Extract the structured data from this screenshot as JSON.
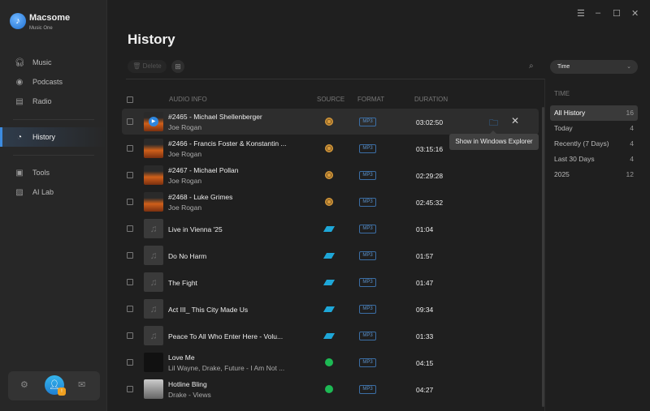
{
  "app": {
    "name": "Macsome",
    "subtitle": "Music One"
  },
  "sidebar": {
    "items": [
      {
        "label": "Music",
        "icon": "headphones-icon"
      },
      {
        "label": "Podcasts",
        "icon": "podcast-icon"
      },
      {
        "label": "Radio",
        "icon": "radio-icon"
      },
      {
        "label": "History",
        "icon": "clock-icon"
      },
      {
        "label": "Tools",
        "icon": "toolbox-icon"
      },
      {
        "label": "AI Lab",
        "icon": "ai-icon"
      }
    ]
  },
  "page": {
    "title": "History",
    "delete_label": "Delete",
    "filter": "Time"
  },
  "table": {
    "headers": {
      "audio_info": "AUDIO INFO",
      "source": "SOURCE",
      "format": "FORMAT",
      "duration": "DURATION"
    },
    "rows": [
      {
        "title": "#2465 - Michael Shellenberger",
        "artist": "Joe Rogan",
        "source": "podcast",
        "format": "MP3",
        "duration": "03:02:50",
        "thumb": "pod"
      },
      {
        "title": "#2466 - Francis Foster & Konstantin ...",
        "artist": "Joe Rogan",
        "source": "podcast",
        "format": "MP3",
        "duration": "03:15:16",
        "thumb": "pod"
      },
      {
        "title": "#2467 - Michael Pollan",
        "artist": "Joe Rogan",
        "source": "podcast",
        "format": "MP3",
        "duration": "02:29:28",
        "thumb": "pod"
      },
      {
        "title": "#2468 - Luke Grimes",
        "artist": "Joe Rogan",
        "source": "podcast",
        "format": "MP3",
        "duration": "02:45:32",
        "thumb": "pod"
      },
      {
        "title": "Live in Vienna '25",
        "artist": "",
        "source": "tidal",
        "format": "MP3",
        "duration": "01:04",
        "thumb": "note"
      },
      {
        "title": "Do No Harm",
        "artist": "",
        "source": "tidal",
        "format": "MP3",
        "duration": "01:57",
        "thumb": "note"
      },
      {
        "title": "The Fight",
        "artist": "",
        "source": "tidal",
        "format": "MP3",
        "duration": "01:47",
        "thumb": "note"
      },
      {
        "title": "Act III_ This City Made Us",
        "artist": "",
        "source": "tidal",
        "format": "MP3",
        "duration": "09:34",
        "thumb": "note"
      },
      {
        "title": "Peace To All Who Enter Here - Volu...",
        "artist": "",
        "source": "tidal",
        "format": "MP3",
        "duration": "01:33",
        "thumb": "note"
      },
      {
        "title": "Love Me",
        "artist": "Lil Wayne, Drake, Future - I Am Not ...",
        "source": "spotify",
        "format": "MP3",
        "duration": "04:15",
        "thumb": "red"
      },
      {
        "title": "Hotline Bling",
        "artist": "Drake - Views",
        "source": "spotify",
        "format": "MP3",
        "duration": "04:27",
        "thumb": "gray"
      }
    ]
  },
  "tooltip": "Show in Windows Explorer",
  "time_filter": {
    "title": "TIME",
    "items": [
      {
        "label": "All History",
        "count": "16"
      },
      {
        "label": "Today",
        "count": "4"
      },
      {
        "label": "Recently (7 Days)",
        "count": "4"
      },
      {
        "label": "Last 30 Days",
        "count": "4"
      },
      {
        "label": "2025",
        "count": "12"
      }
    ]
  }
}
